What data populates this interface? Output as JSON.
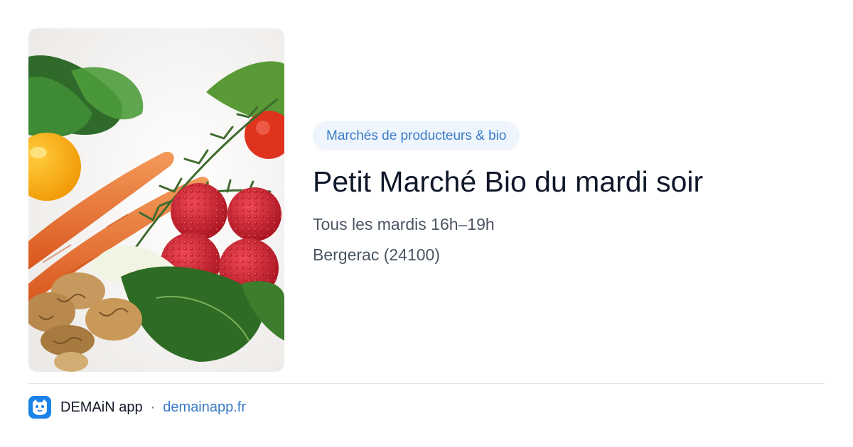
{
  "card": {
    "image": {
      "icon": "vegetables-photo",
      "alt": ""
    },
    "category": "Marchés de producteurs & bio",
    "title": "Petit Marché Bio du mardi soir",
    "schedule": "Tous les mardis 16h–19h",
    "location": "Bergerac (24100)"
  },
  "footer": {
    "app_icon": "demain-logo-icon",
    "app_name": "DEMAiN app",
    "separator": "·",
    "domain": "demainapp.fr"
  },
  "colors": {
    "chip_bg": "#eef5fc",
    "accent": "#3a7bc8",
    "title": "#0f1729",
    "meta": "#4b5563",
    "logo": "#1a83e8"
  }
}
